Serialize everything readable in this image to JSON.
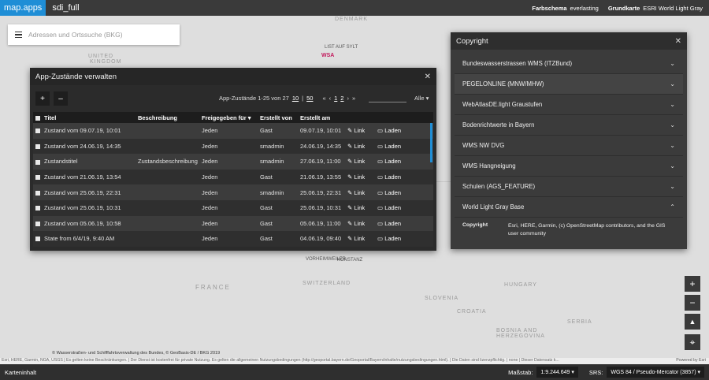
{
  "topbar": {
    "brand": "map.apps",
    "app_name": "sdi_full",
    "scheme_label": "Farbschema",
    "scheme_value": "everlasting",
    "basemap_label": "Grundkarte",
    "basemap_value": "ESRI World Light Gray"
  },
  "search": {
    "placeholder": "Adressen und Ortssuche (BKG)"
  },
  "map_labels": {
    "denmark": "DENMARK",
    "united_kingdom": "UNITED\nKINGDOM",
    "france": "FRANCE",
    "switzerland": "SWITZERLAND",
    "slovenia": "SLOVENIA",
    "hungary": "HUNGARY",
    "croatia": "CROATIA",
    "serbia": "SERBIA",
    "bosnia": "BOSNIA AND\nHERZEGOVINA",
    "list_sylt": "LIST AUF SYLT",
    "konstanz": "KONSTANZ",
    "wsa": "WSA",
    "vorheim": "VORHEIMWEILER"
  },
  "dialog": {
    "title": "App-Zustände verwalten",
    "add_button": "+",
    "remove_button": "–",
    "pager_text": "App-Zustände 1-25 von 27",
    "page_size_1": "10",
    "page_size_2": "50",
    "page_first": "«",
    "page_prev": "‹",
    "page_1": "1",
    "page_2": "2",
    "page_next": "›",
    "page_last": "»",
    "filter_label": "Alle",
    "columns": [
      "Titel",
      "Beschreibung",
      "Freigegeben für",
      "Erstellt von",
      "Erstellt am"
    ],
    "link_label": "Link",
    "load_label": "Laden",
    "rows": [
      {
        "title": "Zustand vom 09.07.19, 10:01",
        "desc": "",
        "shared": "Jeden",
        "by": "Gast",
        "date": "09.07.19, 10:01"
      },
      {
        "title": "Zustand vom 24.06.19, 14:35",
        "desc": "",
        "shared": "Jeden",
        "by": "smadmin",
        "date": "24.06.19, 14:35"
      },
      {
        "title": "Zustandstitel",
        "desc": "Zustandsbeschreibung",
        "shared": "Jeden",
        "by": "smadmin",
        "date": "27.06.19, 11:00"
      },
      {
        "title": "Zustand vom 21.06.19, 13:54",
        "desc": "",
        "shared": "Jeden",
        "by": "Gast",
        "date": "21.06.19, 13:55"
      },
      {
        "title": "Zustand vom 25.06.19, 22:31",
        "desc": "",
        "shared": "Jeden",
        "by": "smadmin",
        "date": "25.06.19, 22:31"
      },
      {
        "title": "Zustand vom 25.06.19, 10:31",
        "desc": "",
        "shared": "Jeden",
        "by": "Gast",
        "date": "25.06.19, 10:31"
      },
      {
        "title": "Zustand vom 05.06.19, 10:58",
        "desc": "",
        "shared": "Jeden",
        "by": "Gast",
        "date": "05.06.19, 11:00"
      },
      {
        "title": "State from 6/4/19, 9:40 AM",
        "desc": "",
        "shared": "Jeden",
        "by": "Gast",
        "date": "04.06.19, 09:40"
      }
    ]
  },
  "copyright": {
    "title": "Copyright",
    "items": [
      "Bundeswasserstrassen WMS (ITZBund)",
      "PEGELONLINE (MNW/MHW)",
      "WebAtlasDE.light Graustufen",
      "Bodenrichtwerte in Bayern",
      "WMS NW DVG",
      "WMS Hangneigung",
      "Schulen (AGS_FEATURE)",
      "World Light Gray Base"
    ],
    "detail_key": "Copyright",
    "detail_value": "Esri, HERE, Garmin, (c) OpenStreetMap contributors, and the GIS user community"
  },
  "map_controls": {
    "zoom_in": "+",
    "zoom_out": "−",
    "north": "▲",
    "measure": "⌖"
  },
  "attribution": {
    "line1": "© Wasserstraßen- und Schifffahrtsverwaltung des Bundes, © GeoBasis-DE / BKG 2019",
    "line2": "Esri, HERE, Garmin, NGA, USGS | Es gelten keine Beschränkungen. | Der Dienst ist kostenfrei für private Nutzung. Es gelten die allgemeinen Nutzungsbedingungen (http://geoportal.bayern.de/Geoportal/Bayern/inhalte/nutzungsbedingungen.html). | Die Daten sind lizenzpflichtig. | none | Dieser Datensatz k...",
    "powered": "Powered by Esri"
  },
  "bottombar": {
    "content_label": "Karteninhalt",
    "scale_label": "Maßstab:",
    "scale_value": "1:9.244.649",
    "srs_label": "SRS:",
    "srs_value": "WGS 84 / Pseudo-Mercator (3857)"
  }
}
